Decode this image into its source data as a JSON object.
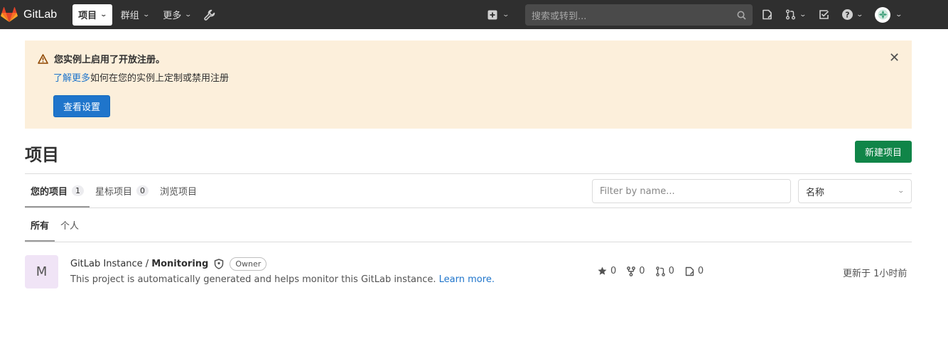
{
  "navbar": {
    "brand": "GitLab",
    "menu": [
      {
        "label": "项目",
        "active": true
      },
      {
        "label": "群组",
        "active": false
      },
      {
        "label": "更多",
        "active": false
      }
    ],
    "search_placeholder": "搜索或转到..."
  },
  "alert": {
    "title": "您实例上启用了开放注册。",
    "link": "了解更多",
    "text": "如何在您的实例上定制或禁用注册",
    "button": "查看设置"
  },
  "page": {
    "title": "项目",
    "new_button": "新建项目"
  },
  "tabs": [
    {
      "label": "您的项目",
      "count": "1"
    },
    {
      "label": "星标项目",
      "count": "0"
    },
    {
      "label": "浏览项目",
      "count": ""
    }
  ],
  "filter": {
    "placeholder": "Filter by name...",
    "sort": "名称"
  },
  "subtabs": [
    "所有",
    "个人"
  ],
  "project": {
    "avatar_letter": "M",
    "namespace": "GitLab Instance /",
    "name": "Monitoring",
    "role": "Owner",
    "description": "This project is automatically generated and helps monitor this GitLab instance.",
    "learn_more": "Learn more.",
    "stars": "0",
    "forks": "0",
    "merge_requests": "0",
    "issues": "0",
    "updated": "更新于 1小时前"
  },
  "colors": {
    "navbar": "#2f2f2f",
    "alert_bg": "#fcefdb",
    "primary": "#1f75cb",
    "success": "#108548",
    "avatar_bg": "#f0e4f6"
  }
}
